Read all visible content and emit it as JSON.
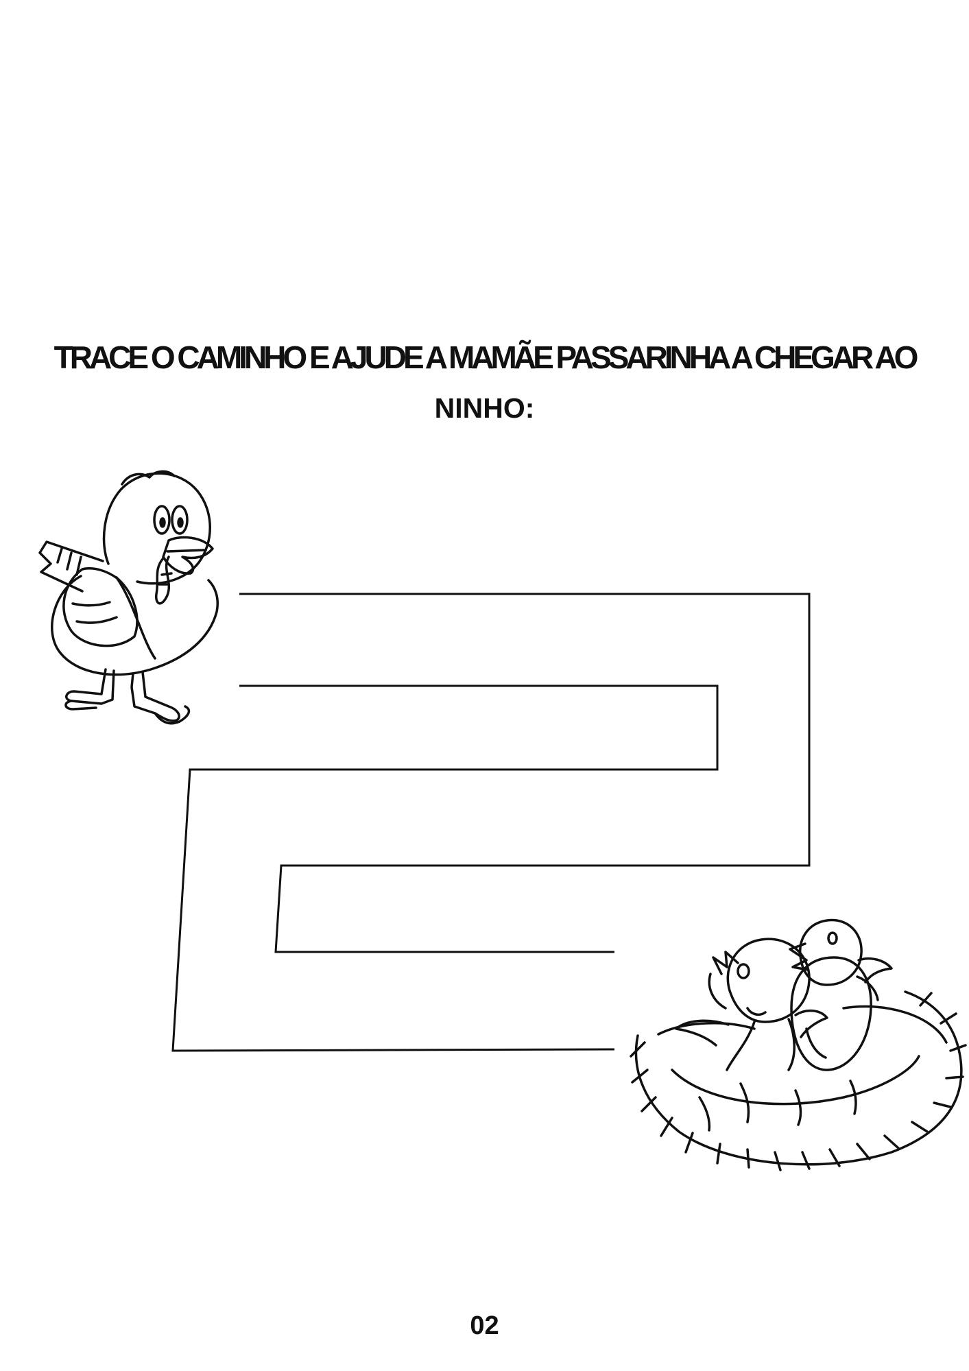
{
  "worksheet": {
    "instruction_line1": "TRACE O CAMINHO E AJUDE A MAMÃE PASSARINHA A CHEGAR AO",
    "instruction_line2": "NINHO:",
    "page_number": "02"
  },
  "illustrations": {
    "start_icon": "mother-bird-icon",
    "goal_icon": "nest-with-chicks-icon",
    "path_icon": "maze-path-icon"
  },
  "colors": {
    "ink": "#111111",
    "paper": "#ffffff"
  }
}
